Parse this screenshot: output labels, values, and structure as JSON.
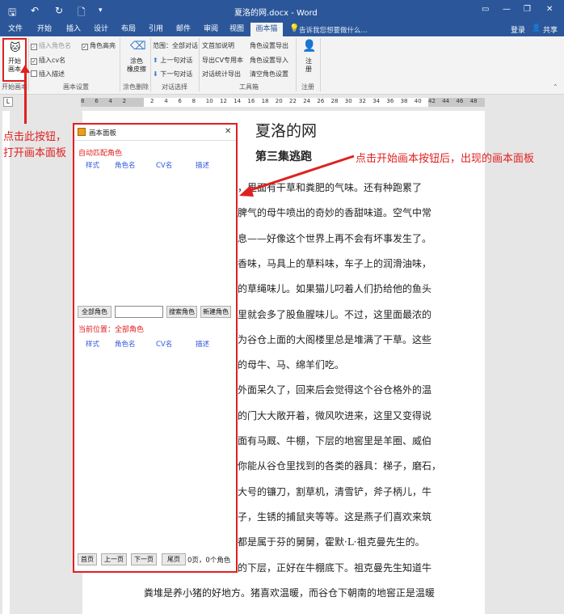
{
  "window": {
    "title": "夏洛的网.docx - Word",
    "minimize_label": "—",
    "restore_label": "❐",
    "close_label": "✕"
  },
  "tabs": [
    "文件",
    "开始",
    "插入",
    "设计",
    "布局",
    "引用",
    "邮件",
    "审阅",
    "视图",
    "画本猫"
  ],
  "tellme": "告诉我您想要做什么...",
  "signin": "登录",
  "share": "共享",
  "ribbon": {
    "start_btn": "开始\n画本",
    "start_group": "开始画本",
    "insert_role_name": "插入角色名",
    "insert_cv_name": "插入cv名",
    "insert_desc": "插入描述",
    "role_highlight": "角色高亮",
    "settings_group": "画本设置",
    "clean_btn": "涂色\n橡皮擦",
    "clean_group": "涂色删除",
    "range_all": "范围：全部对话",
    "prev_dialog": "上一句对话",
    "next_dialog": "下一句对话",
    "dialog_group": "对话选择",
    "add_desc": "文首加说明",
    "export_cv": "导出CV专用本",
    "export_stats": "对话统计导出",
    "export_roles": "角色设置导出",
    "import_roles": "角色设置导入",
    "clear_roles": "清空角色设置",
    "tools_group": "工具箱",
    "register_btn": "注\n册",
    "register_group": "注册"
  },
  "ruler": {
    "left_marker": "L",
    "ticks": [
      "8",
      "6",
      "4",
      "2",
      "",
      "2",
      "4",
      "6",
      "8",
      "10",
      "12",
      "14",
      "16",
      "18",
      "20",
      "22",
      "24",
      "26",
      "28",
      "30",
      "32",
      "34",
      "36",
      "38",
      "40",
      "42",
      "44",
      "46",
      "48"
    ]
  },
  "document": {
    "title": "夏洛的网",
    "subtitle": "第三集逃跑",
    "lines": [
      "，里面有干草和粪肥的气味。还有种跑累了",
      "脾气的母牛喷出的奇妙的香甜味道。空气中常",
      "息——好像这个世界上再不会有坏事发生了。",
      "香味，马具上的草料味，车子上的润滑油味，",
      "的草绳味儿。如果猫儿叼着人们扔给他的鱼头",
      "里就会多了股鱼腥味儿。不过，这里面最浓的",
      "为谷仓上面的大阁楼里总是堆满了干草。这些",
      "的母牛、马、绵羊们吃。",
      "外面呆久了，回来后会觉得这个谷仓格外的温",
      "的门大大敞开着，微风吹进来，这里又变得说",
      "面有马厩、牛棚，下层的地窖里是羊圈、威伯",
      "你能从谷仓里找到的各类的器具：梯子，磨石，",
      "大号的镰刀，割草机，清雪铲，斧子柄儿，牛",
      "子，生锈的捕鼠夹等等。这是燕子们喜欢来筑",
      "都是属于芬的舅舅，霍默·L·祖克曼先生的。",
      "的下层，正好在牛棚底下。祖克曼先生知道牛",
      "粪堆是养小猪的好地方。猪喜欢温暖，而谷仓下朝南的地窖正是温暖"
    ]
  },
  "panel": {
    "title": "画本面板",
    "close": "✕",
    "auto_match": "自动匹配角色",
    "cols": [
      "样式",
      "角色名",
      "CV名",
      "描述"
    ],
    "all_roles_btn": "全部角色",
    "search_value": "",
    "search_btn": "搜索角色",
    "new_btn": "新建角色",
    "current_pos": "当前位置：全部角色",
    "first_btn": "首页",
    "prev_btn": "上一页",
    "next_btn": "下一页",
    "last_btn": "尾页",
    "page_info": "0页，0个角色"
  },
  "annotations": {
    "left": "点击此按钮，\n打开画本面板",
    "right": "点击开始画本按钮后，出现的画本面板"
  },
  "colors": {
    "word_blue": "#2b579a",
    "annotation_red": "#e02020",
    "link_blue": "#3355dd"
  }
}
